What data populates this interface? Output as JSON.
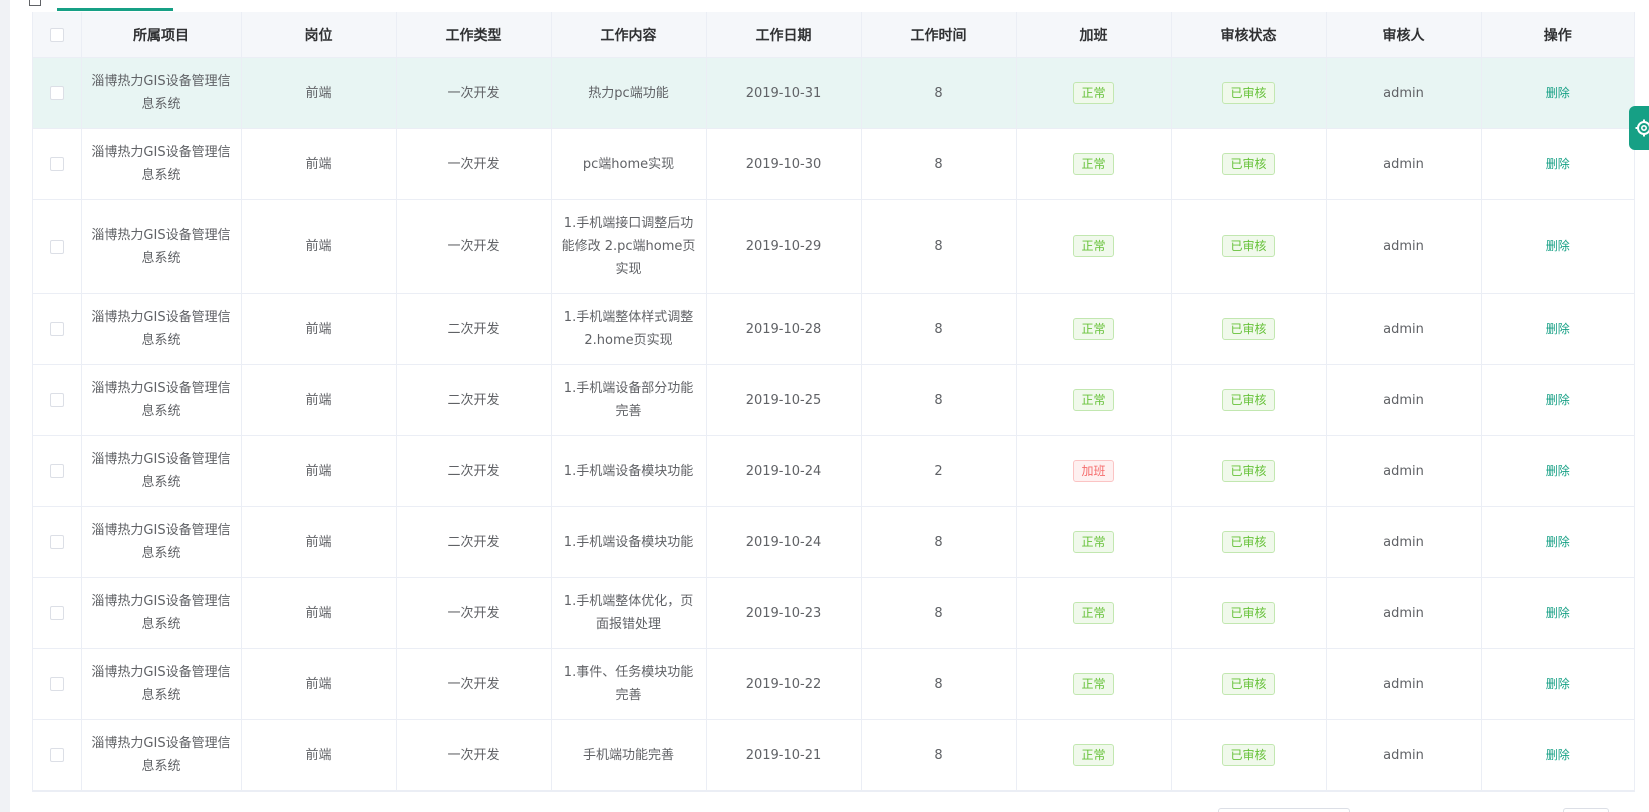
{
  "colors": {
    "accent": "#16a085",
    "tag_success": "#67c23a",
    "tag_danger": "#f56c6c",
    "row_highlight": "#e8f5f3"
  },
  "table": {
    "headers": {
      "project": "所属项目",
      "position": "岗位",
      "work_type": "工作类型",
      "work_content": "工作内容",
      "work_date": "工作日期",
      "work_hours": "工作时间",
      "overtime": "加班",
      "review_status": "审核状态",
      "reviewer": "审核人",
      "actions": "操作"
    },
    "rows": [
      {
        "project": "淄博热力GIS设备管理信息系统",
        "position": "前端",
        "work_type": "一次开发",
        "work_content": "热力pc端功能",
        "work_date": "2019-10-31",
        "work_hours": "8",
        "overtime": "正常",
        "overtime_kind": "normal",
        "review_status": "已审核",
        "reviewer": "admin",
        "action": "删除",
        "highlighted": true
      },
      {
        "project": "淄博热力GIS设备管理信息系统",
        "position": "前端",
        "work_type": "一次开发",
        "work_content": "pc端home实现",
        "work_date": "2019-10-30",
        "work_hours": "8",
        "overtime": "正常",
        "overtime_kind": "normal",
        "review_status": "已审核",
        "reviewer": "admin",
        "action": "删除"
      },
      {
        "project": "淄博热力GIS设备管理信息系统",
        "position": "前端",
        "work_type": "一次开发",
        "work_content": "1.手机端接口调整后功能修改 2.pc端home页实现",
        "work_date": "2019-10-29",
        "work_hours": "8",
        "overtime": "正常",
        "overtime_kind": "normal",
        "review_status": "已审核",
        "reviewer": "admin",
        "action": "删除"
      },
      {
        "project": "淄博热力GIS设备管理信息系统",
        "position": "前端",
        "work_type": "二次开发",
        "work_content": "1.手机端整体样式调整 2.home页实现",
        "work_date": "2019-10-28",
        "work_hours": "8",
        "overtime": "正常",
        "overtime_kind": "normal",
        "review_status": "已审核",
        "reviewer": "admin",
        "action": "删除"
      },
      {
        "project": "淄博热力GIS设备管理信息系统",
        "position": "前端",
        "work_type": "二次开发",
        "work_content": "1.手机端设备部分功能完善",
        "work_date": "2019-10-25",
        "work_hours": "8",
        "overtime": "正常",
        "overtime_kind": "normal",
        "review_status": "已审核",
        "reviewer": "admin",
        "action": "删除"
      },
      {
        "project": "淄博热力GIS设备管理信息系统",
        "position": "前端",
        "work_type": "二次开发",
        "work_content": "1.手机端设备模块功能",
        "work_date": "2019-10-24",
        "work_hours": "2",
        "overtime": "加班",
        "overtime_kind": "overtime",
        "review_status": "已审核",
        "reviewer": "admin",
        "action": "删除"
      },
      {
        "project": "淄博热力GIS设备管理信息系统",
        "position": "前端",
        "work_type": "二次开发",
        "work_content": "1.手机端设备模块功能",
        "work_date": "2019-10-24",
        "work_hours": "8",
        "overtime": "正常",
        "overtime_kind": "normal",
        "review_status": "已审核",
        "reviewer": "admin",
        "action": "删除"
      },
      {
        "project": "淄博热力GIS设备管理信息系统",
        "position": "前端",
        "work_type": "一次开发",
        "work_content": "1.手机端整体优化，页面报错处理",
        "work_date": "2019-10-23",
        "work_hours": "8",
        "overtime": "正常",
        "overtime_kind": "normal",
        "review_status": "已审核",
        "reviewer": "admin",
        "action": "删除"
      },
      {
        "project": "淄博热力GIS设备管理信息系统",
        "position": "前端",
        "work_type": "一次开发",
        "work_content": "1.事件、任务模块功能完善",
        "work_date": "2019-10-22",
        "work_hours": "8",
        "overtime": "正常",
        "overtime_kind": "normal",
        "review_status": "已审核",
        "reviewer": "admin",
        "action": "删除"
      },
      {
        "project": "淄博热力GIS设备管理信息系统",
        "position": "前端",
        "work_type": "一次开发",
        "work_content": "手机端功能完善",
        "work_date": "2019-10-21",
        "work_hours": "8",
        "overtime": "正常",
        "overtime_kind": "normal",
        "review_status": "已审核",
        "reviewer": "admin",
        "action": "删除"
      }
    ]
  },
  "side_panel": {
    "icon": "gear-icon"
  }
}
